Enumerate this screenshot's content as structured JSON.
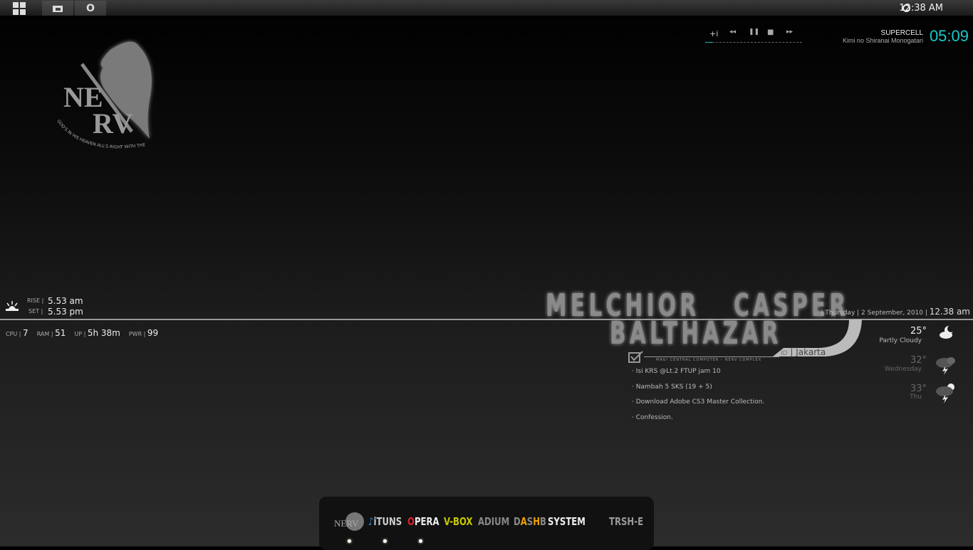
{
  "topbar": {
    "start_icon": "windows-grid-icon",
    "explorer_icon": "folder-icon",
    "opera_label": "O",
    "clock": "12:38 AM",
    "clock_icon": "clock-icon"
  },
  "player": {
    "rate_label": "+i",
    "prev_icon": "rewind-icon",
    "pause_icon": "pause-icon",
    "stop_icon": "stop-icon",
    "next_icon": "fast-forward-icon",
    "artist": "SUPERCELL",
    "title": "Kimi no Shiranai Monogatari",
    "time": "05:09",
    "progress": 0.07,
    "accent": "#19c8c8"
  },
  "logo": {
    "text": "NERV",
    "motto": "GOD'S IN HIS HEAVEN ALL'S RIGHT WITH THE WORLD"
  },
  "sun": {
    "rise_label": "RISE",
    "rise": "5.53 am",
    "set_label": "SET",
    "set": "5.53 pm"
  },
  "stats": [
    {
      "label": "CPU",
      "value": "7"
    },
    {
      "label": "RAM",
      "value": "51"
    },
    {
      "label": "UP",
      "value": "5h 38m"
    },
    {
      "label": "PWR",
      "value": "99"
    }
  ],
  "magi": {
    "melchior": "MELCHIOR",
    "casper": "CASPER",
    "balthazar": "BALTHAZAR",
    "subtitle": "MAGI CENTRAL COMPUTER – NERV COMPLEX",
    "country": "ID",
    "city": "Jakarta"
  },
  "date": {
    "day": "Thursday",
    "date": "2 September, 2010",
    "time": "12.38 am"
  },
  "todos": [
    "· Isi KRS @Lt.2 FTUP jam 10",
    "· Nambah 5 SKS (19 + 5)",
    "· Download Adobe CS3 Master Collection.",
    "· Confession."
  ],
  "weather": [
    {
      "temp": "25°",
      "label": "Partly Cloudy",
      "icon": "moon-cloud-icon"
    },
    {
      "temp": "32°",
      "label": "Wednesday",
      "icon": "thunderstorm-icon"
    },
    {
      "temp": "33°",
      "label": "Thu",
      "icon": "sun-thunderstorm-icon"
    }
  ],
  "dock": {
    "items": [
      {
        "label": "iTUNS",
        "color": "#cccccc",
        "accent": "#2a8ae0"
      },
      {
        "label": "PERA",
        "first": "O",
        "color": "#eeeeee",
        "accent": "#e0202a"
      },
      {
        "label": "V-BOX",
        "color": "#c8c800"
      },
      {
        "label": "ADIUM",
        "color": "#888888"
      },
      {
        "label": "DASHB",
        "color": "#888888",
        "accent": "#f0a000"
      },
      {
        "label": "SYSTEM",
        "color": "#eeeeee"
      },
      {
        "label": "TRSH-E",
        "color": "#999999"
      }
    ]
  }
}
